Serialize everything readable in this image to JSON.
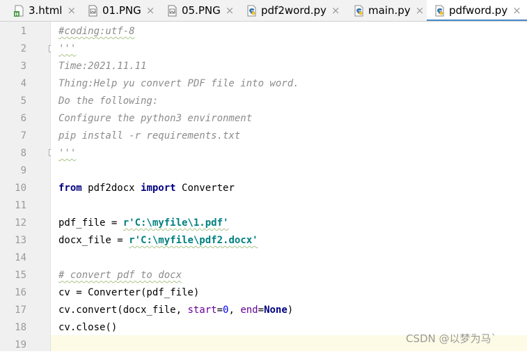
{
  "tabs": [
    {
      "label": "3.html",
      "icon": "html-file-icon",
      "active": false
    },
    {
      "label": "01.PNG",
      "icon": "image-file-icon",
      "active": false
    },
    {
      "label": "05.PNG",
      "icon": "image-file-icon",
      "active": false
    },
    {
      "label": "pdf2word.py",
      "icon": "python-file-icon",
      "active": false
    },
    {
      "label": "main.py",
      "icon": "python-file-icon",
      "active": false
    },
    {
      "label": "pdfword.py",
      "icon": "python-file-icon",
      "active": true
    }
  ],
  "close_glyph": "×",
  "line_numbers": [
    "1",
    "2",
    "3",
    "4",
    "5",
    "6",
    "7",
    "8",
    "9",
    "10",
    "11",
    "12",
    "13",
    "14",
    "15",
    "16",
    "17",
    "18",
    "19"
  ],
  "code": {
    "l1": "#coding:utf-8",
    "l2": "'''",
    "l3": "Time:2021.11.11",
    "l4": "Thing:Help yu convert PDF file into word.",
    "l5": "Do the following:",
    "l6": "Configure the python3 environment",
    "l7": "pip install -r requirements.txt",
    "l8": "'''",
    "l10_from": "from",
    "l10_mod": " pdf2docx ",
    "l10_import": "import",
    "l10_name": " Converter",
    "l12_lhs": "pdf_file = ",
    "l12_str": "r'C:\\myfile\\1.pdf'",
    "l13_lhs": "docx_file = ",
    "l13_str": "r'C:\\myfile\\pdf2.docx'",
    "l15": "# convert pdf to docx",
    "l16": "cv = Converter(pdf_file)",
    "l17_a": "cv.convert(docx_file, ",
    "l17_start": "start",
    "l17_eq1": "=",
    "l17_zero": "0",
    "l17_comma": ", ",
    "l17_end": "end",
    "l17_eq2": "=",
    "l17_none": "None",
    "l17_close": ")",
    "l18": "cv.close()"
  },
  "watermark": "CSDN @以梦为马`",
  "colors": {
    "accent": "#4a88c7",
    "docstring": "#8c8c8c",
    "keyword": "#000080",
    "string": "#008080",
    "number": "#0000ff",
    "keyword_arg": "#660099"
  }
}
